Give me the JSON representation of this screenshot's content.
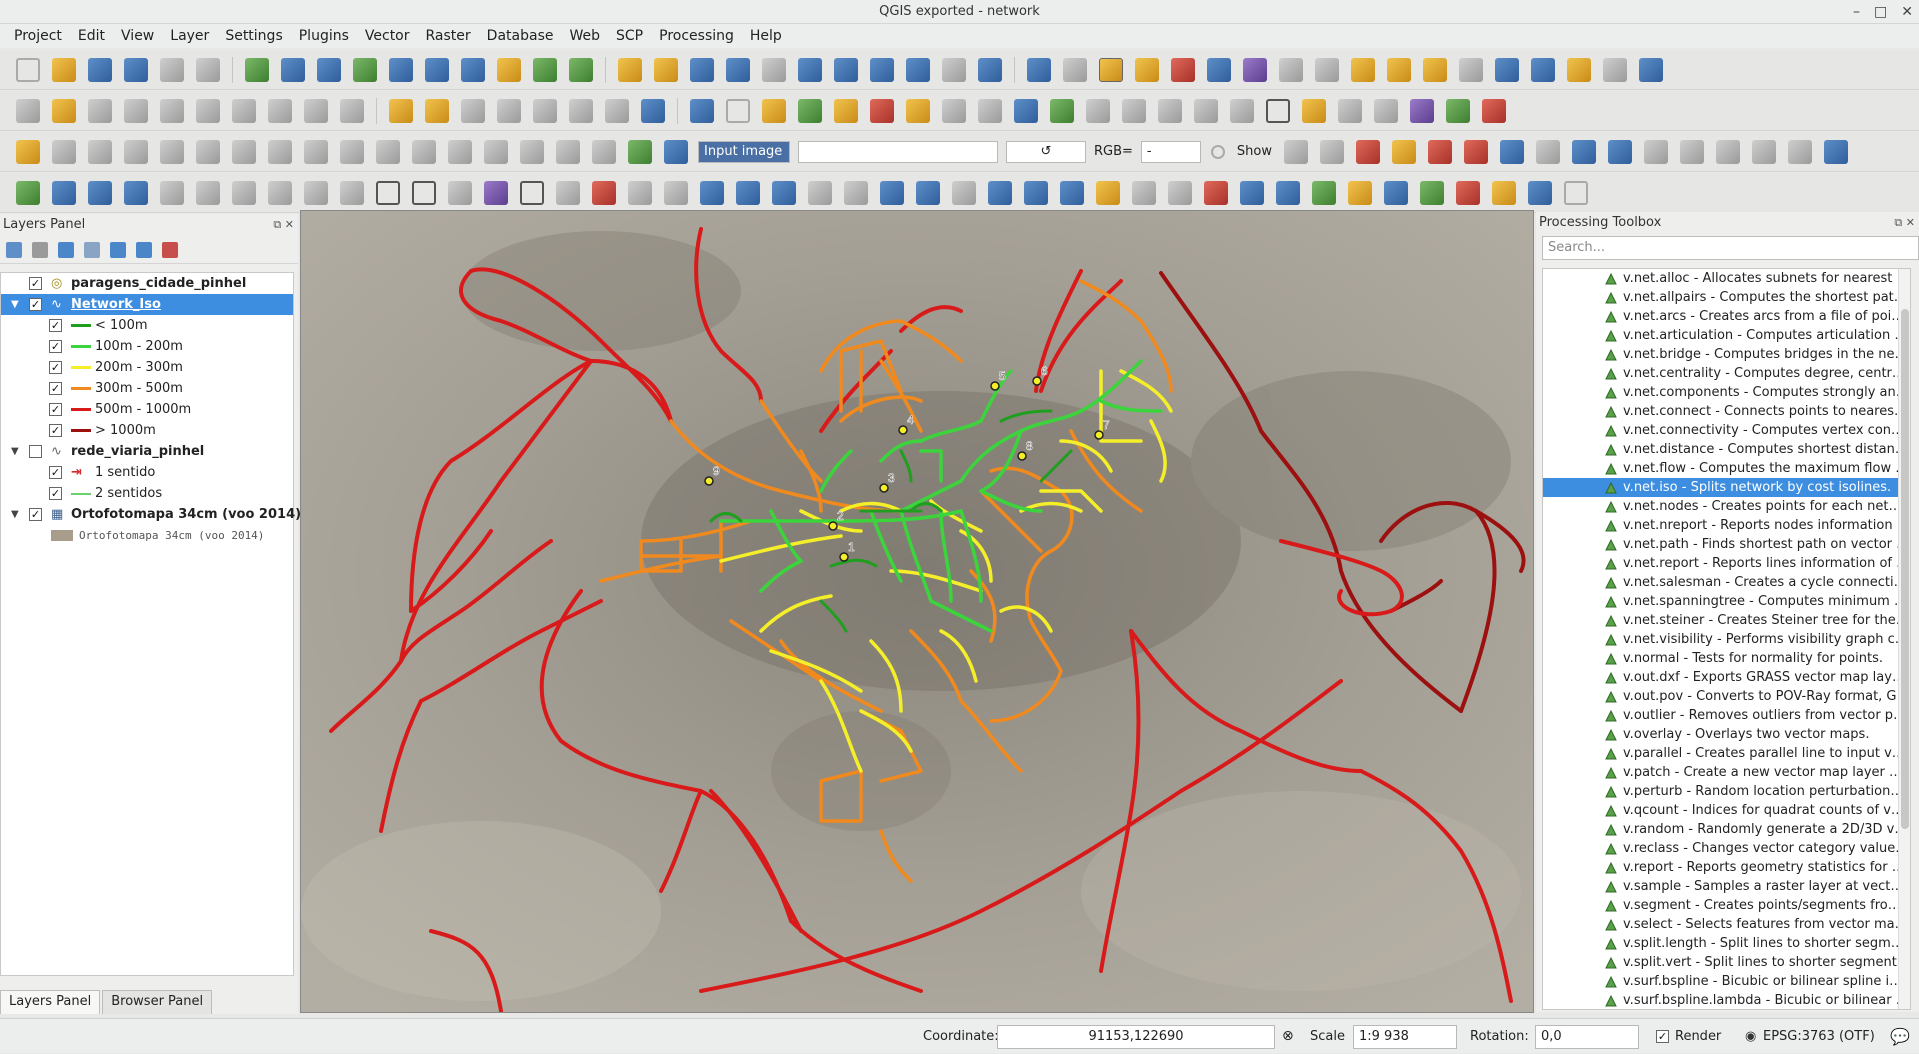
{
  "window": {
    "title": "QGIS exported - network",
    "controls": [
      "–",
      "□",
      "✕"
    ]
  },
  "menu": [
    "Project",
    "Edit",
    "View",
    "Layer",
    "Settings",
    "Plugins",
    "Vector",
    "Raster",
    "Database",
    "Web",
    "SCP",
    "Processing",
    "Help"
  ],
  "toolbar3": {
    "input_image_label": "Input image",
    "rgb_label": "RGB=",
    "rgb_value": "-",
    "show_label": "Show"
  },
  "layers_panel": {
    "title": "Layers Panel",
    "items": [
      {
        "name": "paragens_cidade_pinhel",
        "checked": true,
        "bold": true
      },
      {
        "name": "Network_Iso",
        "checked": true,
        "bold": true,
        "selected": true
      },
      {
        "name": "< 100m",
        "color": "#1f9e1f"
      },
      {
        "name": "100m - 200m",
        "color": "#3cd43c"
      },
      {
        "name": "200m - 300m",
        "color": "#f5ef2a"
      },
      {
        "name": "300m - 500m",
        "color": "#f08a1e"
      },
      {
        "name": "500m - 1000m",
        "color": "#d81a1a"
      },
      {
        "name": "> 1000m",
        "color": "#9c1010"
      },
      {
        "name": "rede_viaria_pinhel",
        "checked": false,
        "bold": true
      },
      {
        "name": "1 sentido",
        "color": "#d42a2a"
      },
      {
        "name": "2 sentidos",
        "color": "#6bd36b"
      },
      {
        "name": "Ortofotomapa 34cm (voo 2014)",
        "checked": true,
        "bold": true
      },
      {
        "name": "Ortofotomapa 34cm (voo 2014)",
        "raster": true
      }
    ],
    "tabs": [
      "Layers Panel",
      "Browser Panel"
    ]
  },
  "map": {
    "stops": [
      "1",
      "2",
      "3",
      "4",
      "5",
      "6",
      "7",
      "8",
      "9"
    ],
    "colors": {
      "lt100": "#1f9e1f",
      "r100_200": "#3cd43c",
      "r200_300": "#f5ef2a",
      "r300_500": "#f08a1e",
      "r500_1000": "#d81a1a",
      "gt1000": "#9c1010"
    }
  },
  "processing": {
    "title": "Processing Toolbox",
    "search_placeholder": "Search...",
    "items": [
      "v.net.alloc - Allocates subnets for nearest ce...",
      "v.net.allpairs - Computes the shortest path b...",
      "v.net.arcs - Creates arcs from a file of points",
      "v.net.articulation - Computes articulation po...",
      "v.net.bridge - Computes bridges in the netw...",
      "v.net.centrality - Computes degree, centralit...",
      "v.net.components - Computes strongly and ...",
      "v.net.connect - Connects points to nearest a...",
      "v.net.connectivity - Computes vertex connec...",
      "v.net.distance - Computes shortest distance ...",
      "v.net.flow - Computes the maximum flow be...",
      "v.net.iso - Splits network by cost isolines.",
      "v.net.nodes - Creates points for each networ...",
      "v.net.nreport - Reports nodes information of...",
      "v.net.path - Finds shortest path on vector ne...",
      "v.net.report - Reports lines information of a ...",
      "v.net.salesman - Creates a cycle connecting ...",
      "v.net.spanningtree - Computes minimum sp...",
      "v.net.steiner - Creates Steiner tree for the ne...",
      "v.net.visibility - Performs visibility graph con...",
      "v.normal - Tests for normality for points.",
      "v.out.dxf - Exports GRASS vector map layers ...",
      "v.out.pov - Converts to POV-Ray format, GRA...",
      "v.outlier - Removes outliers from vector poin...",
      "v.overlay - Overlays two vector maps.",
      "v.parallel - Creates parallel line to input vect...",
      "v.patch - Create a new vector map layer by c...",
      "v.perturb - Random location perturbations o...",
      "v.qcount - Indices for quadrat counts of vect...",
      "v.random - Randomly generate a 2D/3D vect...",
      "v.reclass - Changes vector category values fo...",
      "v.report - Reports geometry statistics for vec...",
      "v.sample - Samples a raster layer at vector p...",
      "v.segment - Creates points/segments from i...",
      "v.select - Selects features from vector map (...",
      "v.split.length - Split lines to shorter segment...",
      "v.split.vert - Split lines to shorter segments b...",
      "v.surf.bspline - Bicubic or bilinear spline inte...",
      "v.surf.bspline.lambda - Bicubic or bilinear sp..."
    ],
    "selected_index": 11
  },
  "statusbar": {
    "coordinate_label": "Coordinate:",
    "coordinate_value": "91153,122690",
    "scale_label": "Scale",
    "scale_value": "1:9 938",
    "rotation_label": "Rotation:",
    "rotation_value": "0,0",
    "render_label": "Render",
    "crs": "EPSG:3763 (OTF)"
  }
}
